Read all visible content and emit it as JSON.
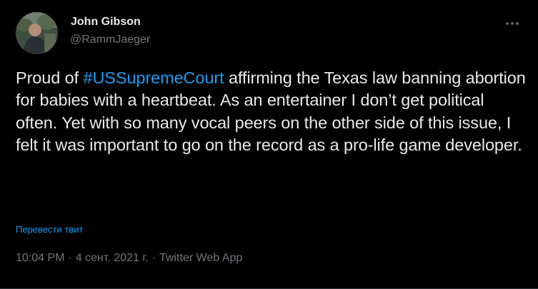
{
  "author": {
    "display_name": "John Gibson",
    "handle": "@RammJaeger",
    "avatar_icon": "user-photo-avatar"
  },
  "menu": {
    "more_icon": "more-horizontal-icon"
  },
  "tweet": {
    "text_before": "Proud of ",
    "hashtag": "#USSupremeCourt",
    "text_after": " affirming the Texas law banning abortion for babies with a heartbeat. As an entertainer I don’t get political often. Yet with so many vocal peers on the other side of this issue, I felt it was important to go on the record as a pro-life game developer.",
    "translate_label": "Перевести твит",
    "time": "10:04 PM",
    "separator": "·",
    "date": "4 сент. 2021 г.",
    "source": "Twitter Web App"
  },
  "colors": {
    "background": "#000000",
    "text": "#e7e9ea",
    "muted": "#71767b",
    "accent": "#1d9bf0"
  }
}
